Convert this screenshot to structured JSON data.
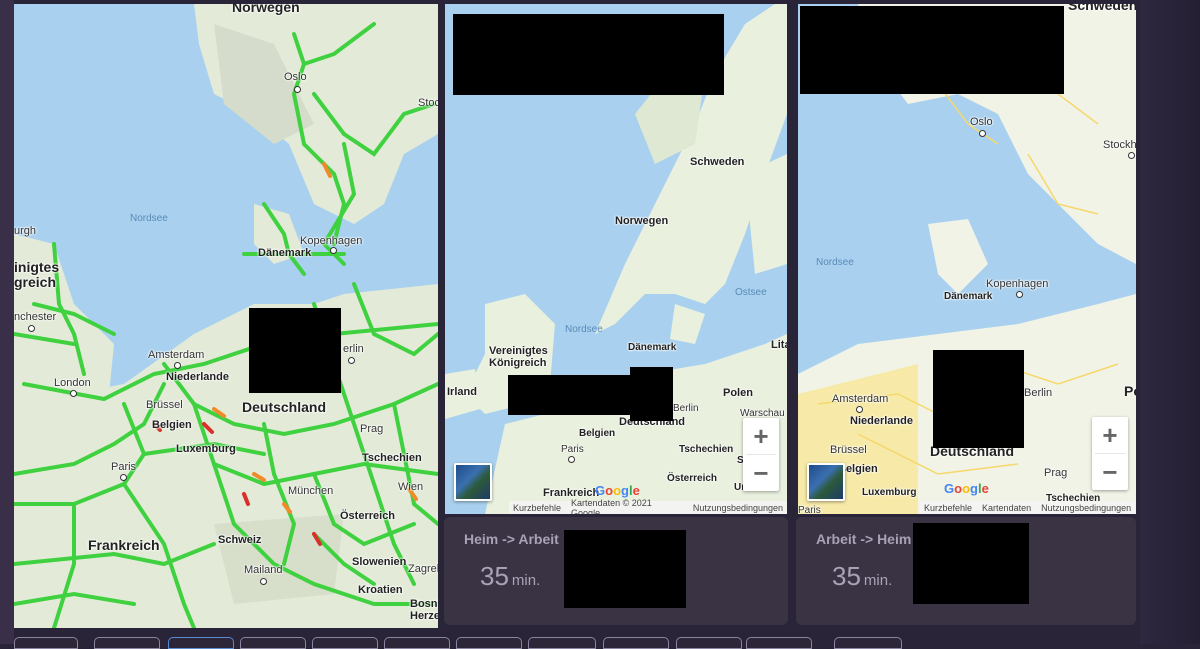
{
  "colors": {
    "traffic_free": "#3fd13f",
    "traffic_slow": "#f08a2a",
    "traffic_jam": "#d9302a",
    "water": "#a9d1ef",
    "land": "#e9f0de",
    "card_bg": "#3a3344"
  },
  "map_left": {
    "labels": {
      "norwegen": "Norwegen",
      "oslo": "Oslo",
      "stockholm": "Stoc",
      "nordsee": "Nordsee",
      "kopenhagen": "Kopenhagen",
      "daenemark": "Dänemark",
      "edinburgh": "urgh",
      "uk": "inigtes\ngreich",
      "manchester": "nchester",
      "amsterdam": "Amsterdam",
      "berlin": "erlin",
      "niederlande": "Niederlande",
      "london": "London",
      "bruessel": "Brüssel",
      "belgien": "Belgien",
      "deutschland": "Deutschland",
      "prag": "Prag",
      "luxemburg": "Luxemburg",
      "tschechien": "Tschechien",
      "paris": "Paris",
      "wien": "Wien",
      "muenchen": "München",
      "oesterreich": "Österreich",
      "frankreich": "Frankreich",
      "schweiz": "Schweiz",
      "slowenien": "Slowenien",
      "zagreb": "Zagreb",
      "mailand": "Mailand",
      "kroatien": "Kroatien",
      "bosnien": "Bosnie\nHerze"
    }
  },
  "map_mid": {
    "labels": {
      "schweden": "Schweden",
      "norwegen": "Norwegen",
      "ostsee": "Ostsee",
      "nordsee": "Nordsee",
      "daenemark": "Dänemark",
      "lita": "Lita",
      "uk": "Vereinigtes\nKönigreich",
      "irland": "Irland",
      "polen": "Polen",
      "berlin": "Berlin",
      "warschau": "Warschau",
      "deutschland": "Deutschland",
      "belgien": "Belgien",
      "paris": "Paris",
      "tschechien": "Tschechien",
      "oesterreich": "Österreich",
      "frankreich": "Frankreich",
      "ung": "Ur",
      "s": "S"
    },
    "attribution": {
      "shortcuts": "Kurzbefehle",
      "mapdata": "Kartendaten © 2021 Google",
      "terms": "Nutzungsbedingungen"
    },
    "zoom_in": "+",
    "zoom_out": "−"
  },
  "map_right": {
    "labels": {
      "schweden": "Schweden",
      "oslo": "Oslo",
      "stockholm": "Stockh",
      "nordsee": "Nordsee",
      "kopenhagen": "Kopenhagen",
      "daenemark": "Dänemark",
      "amsterdam": "Amsterdam",
      "berlin": "Berlin",
      "po": "Po",
      "niederlande": "Niederlande",
      "bruessel": "Brüssel",
      "belgien": "Belgien",
      "deutschland": "Deutschland",
      "prag": "Prag",
      "luxemburg": "Luxemburg",
      "paris": "Paris",
      "tschechien": "Tschechien"
    },
    "attribution": {
      "shortcuts": "Kurzbefehle",
      "mapdata": "Kartendaten",
      "terms": "Nutzungsbedingungen"
    },
    "zoom_in": "+",
    "zoom_out": "−"
  },
  "google_logo": "Google",
  "card_home_work": {
    "title": "Heim -> Arbeit",
    "value": "35",
    "unit": "min."
  },
  "card_work_home": {
    "title": "Arbeit -> Heim",
    "value": "35",
    "unit": "min."
  }
}
